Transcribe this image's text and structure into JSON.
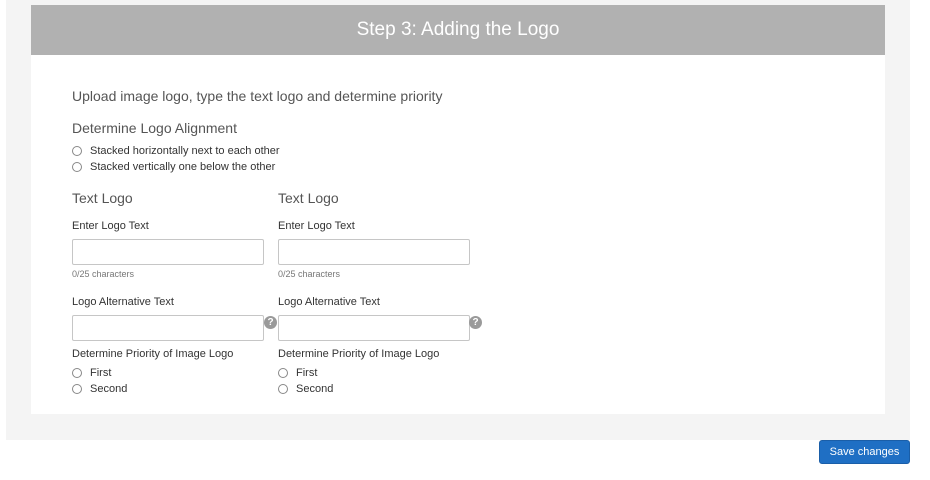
{
  "header": {
    "title": "Step 3: Adding the Logo"
  },
  "intro": {
    "text": "Upload image logo, type the text logo and determine priority"
  },
  "alignment": {
    "heading": "Determine Logo Alignment",
    "options": [
      "Stacked horizontally next to each other",
      "Stacked vertically one below the other"
    ]
  },
  "columns": [
    {
      "title": "Text Logo",
      "logo_text_label": "Enter Logo Text",
      "logo_text_value": "",
      "counter": "0/25 characters",
      "alt_text_label": "Logo Alternative Text",
      "alt_text_value": "",
      "priority_label": "Determine Priority of Image Logo",
      "priority_options": [
        "First",
        "Second"
      ]
    },
    {
      "title": "Text Logo",
      "logo_text_label": "Enter Logo Text",
      "logo_text_value": "",
      "counter": "0/25 characters",
      "alt_text_label": "Logo Alternative Text",
      "alt_text_value": "",
      "priority_label": "Determine Priority of Image Logo",
      "priority_options": [
        "First",
        "Second"
      ]
    }
  ],
  "help_icon_glyph": "?",
  "footer": {
    "save_label": "Save changes"
  },
  "colors": {
    "header_bg": "#b1b1b1",
    "primary_button": "#1f6fc4"
  }
}
